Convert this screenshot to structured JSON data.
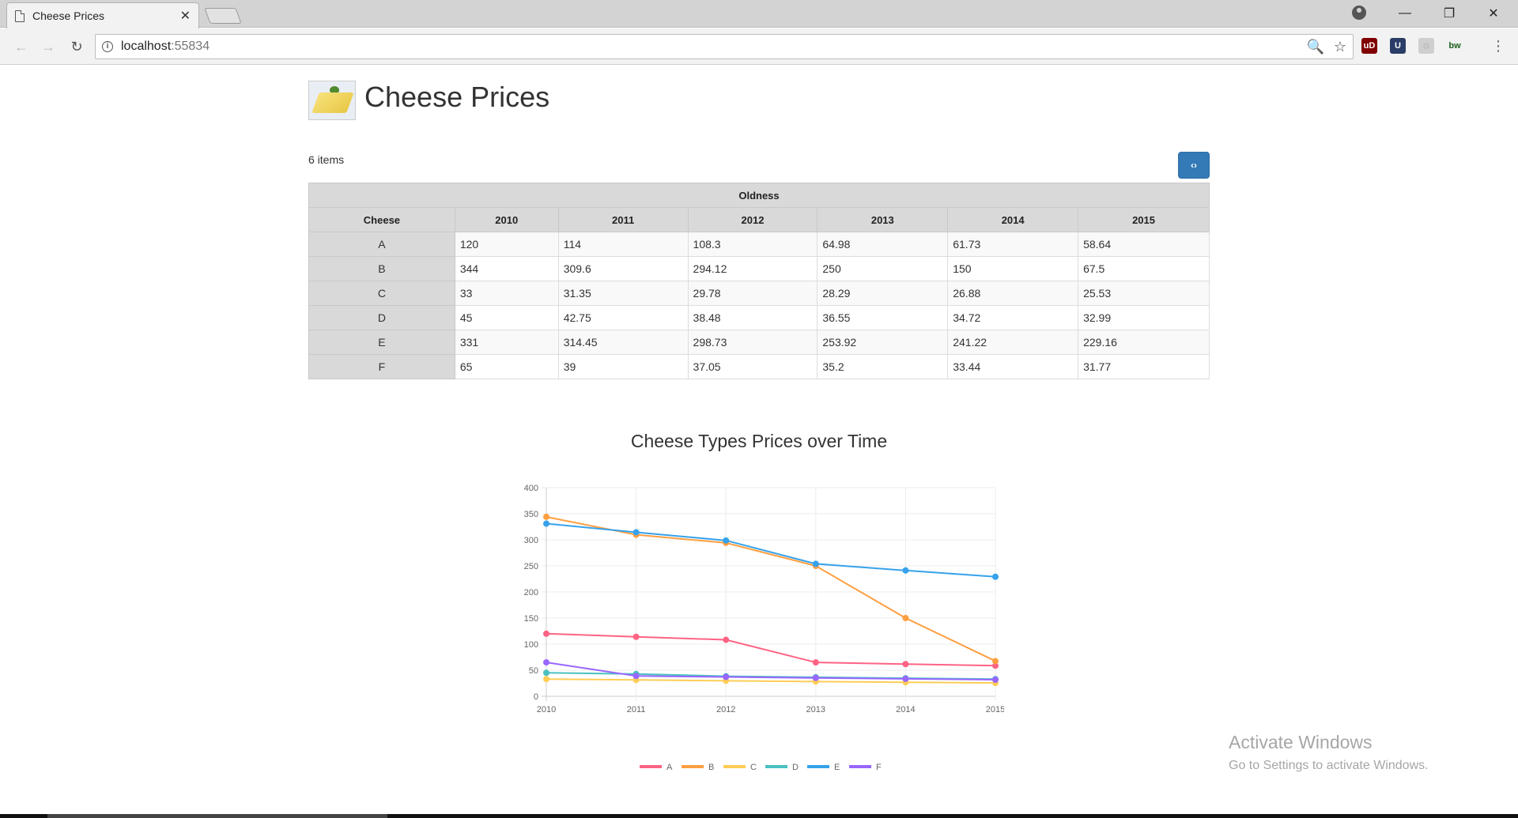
{
  "browser": {
    "tab_title": "Cheese Prices",
    "url_host": "localhost",
    "url_port": ":55834",
    "tab_close": "✕",
    "back": "←",
    "forward": "→",
    "reload": "↻",
    "zoom_icon": "🔍",
    "bookmark_icon": "☆",
    "minimize": "—",
    "restore": "❐",
    "close": "✕",
    "menu": "⋮",
    "extensions": [
      {
        "label": "uD",
        "color": "#800000"
      },
      {
        "label": "U",
        "color": "#2a3d66"
      },
      {
        "label": "⚙",
        "color": "#cfcfcf"
      },
      {
        "label": "bw",
        "color": "#f2f2f2"
      }
    ]
  },
  "header": {
    "title": "Cheese Prices"
  },
  "list": {
    "items_count": "6 items",
    "toggle_label": "‹›"
  },
  "table": {
    "group_header": "Oldness",
    "columns": [
      "Cheese",
      "2010",
      "2011",
      "2012",
      "2013",
      "2014",
      "2015"
    ],
    "rows": [
      {
        "name": "A",
        "values": [
          "120",
          "114",
          "108.3",
          "64.98",
          "61.73",
          "58.64"
        ]
      },
      {
        "name": "B",
        "values": [
          "344",
          "309.6",
          "294.12",
          "250",
          "150",
          "67.5"
        ]
      },
      {
        "name": "C",
        "values": [
          "33",
          "31.35",
          "29.78",
          "28.29",
          "26.88",
          "25.53"
        ]
      },
      {
        "name": "D",
        "values": [
          "45",
          "42.75",
          "38.48",
          "36.55",
          "34.72",
          "32.99"
        ]
      },
      {
        "name": "E",
        "values": [
          "331",
          "314.45",
          "298.73",
          "253.92",
          "241.22",
          "229.16"
        ]
      },
      {
        "name": "F",
        "values": [
          "65",
          "39",
          "37.05",
          "35.2",
          "33.44",
          "31.77"
        ]
      }
    ]
  },
  "chart_data": {
    "type": "line",
    "title": "Cheese Types Prices over Time",
    "xlabel": "",
    "ylabel": "",
    "x": [
      "2010",
      "2011",
      "2012",
      "2013",
      "2014",
      "2015"
    ],
    "ylim": [
      0,
      400
    ],
    "yticks": [
      0,
      50,
      100,
      150,
      200,
      250,
      300,
      350,
      400
    ],
    "grid": true,
    "legend_position": "bottom",
    "series": [
      {
        "name": "A",
        "color": "#ff6384",
        "values": [
          120,
          114,
          108.3,
          64.98,
          61.73,
          58.64
        ]
      },
      {
        "name": "B",
        "color": "#ff9f40",
        "values": [
          344,
          309.6,
          294.12,
          250,
          150,
          67.5
        ]
      },
      {
        "name": "C",
        "color": "#ffcd56",
        "values": [
          33,
          31.35,
          29.78,
          28.29,
          26.88,
          25.53
        ]
      },
      {
        "name": "D",
        "color": "#4bc0c0",
        "values": [
          45,
          42.75,
          38.48,
          36.55,
          34.72,
          32.99
        ]
      },
      {
        "name": "E",
        "color": "#36a2eb",
        "values": [
          331,
          314.45,
          298.73,
          253.92,
          241.22,
          229.16
        ]
      },
      {
        "name": "F",
        "color": "#9966ff",
        "values": [
          65,
          39,
          37.05,
          35.2,
          33.44,
          31.77
        ]
      }
    ]
  },
  "watermark": {
    "line1": "Activate Windows",
    "line2": "Go to Settings to activate Windows."
  }
}
